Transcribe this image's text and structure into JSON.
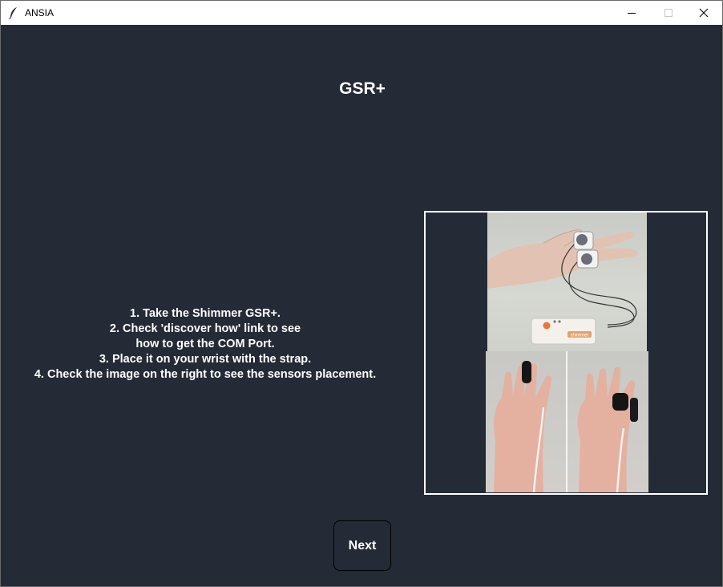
{
  "window": {
    "title": "ANSIA",
    "icon": "feather-icon",
    "controls": {
      "minimize_icon": "minimize-icon",
      "maximize_icon": "maximize-icon",
      "close_icon": "close-icon"
    }
  },
  "page": {
    "title": "GSR+",
    "instructions": [
      "1. Take the Shimmer GSR+.",
      "2. Check 'discover how' link to see",
      "how to get the COM Port.",
      "3. Place it on your wrist with the strap.",
      "4. Check the image on the right to see the sensors placement."
    ],
    "device_label": "shimmer",
    "next_label": "Next"
  },
  "colors": {
    "background": "#242a36",
    "text": "#ffffff",
    "titlebar": "#ffffff"
  }
}
